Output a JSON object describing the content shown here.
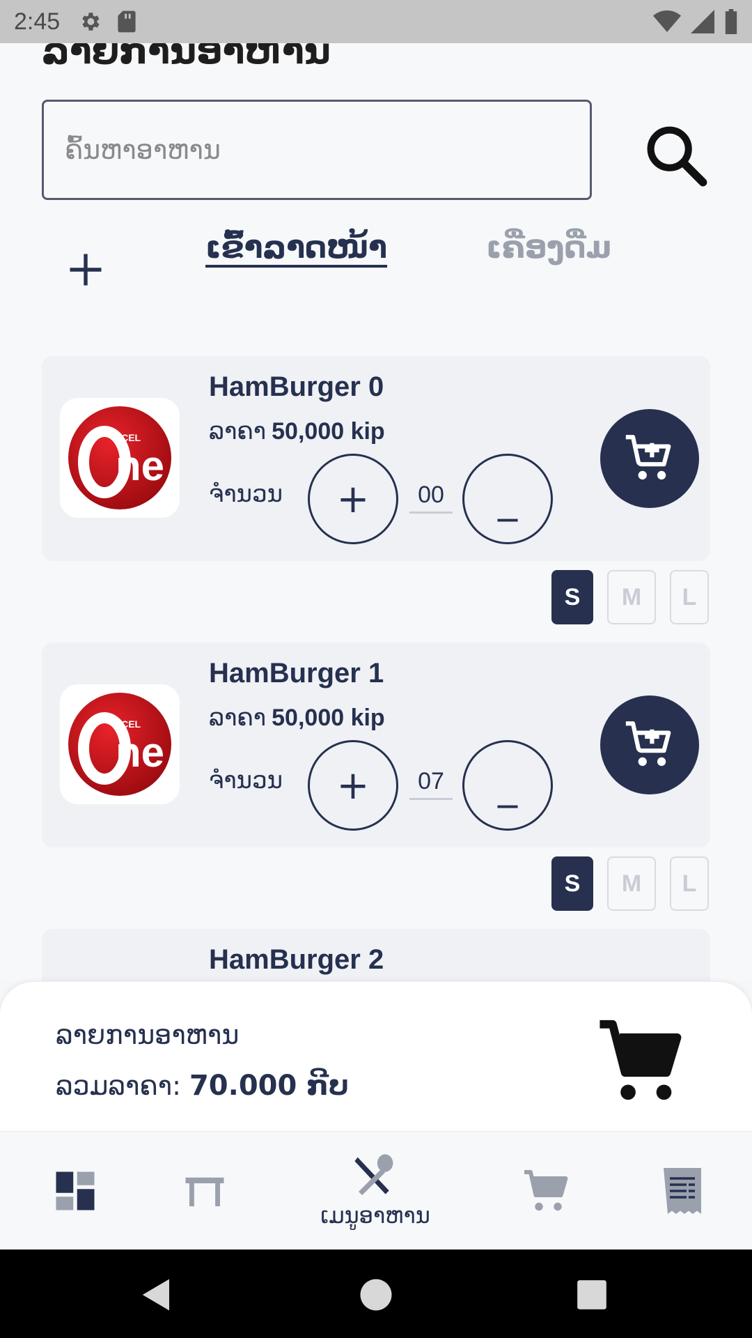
{
  "status_bar": {
    "time": "2:45"
  },
  "page": {
    "title": "ລາຍການອາຫານ"
  },
  "search": {
    "placeholder": "ຄົ້ນຫາອາຫານ"
  },
  "tabs": [
    {
      "label": "ເຂົ້າລາດໜ້າ",
      "active": true
    },
    {
      "label": "ເຄື່ອງດື່ມ",
      "active": false
    }
  ],
  "cards": [
    {
      "name": "HamBurger 0",
      "price_label": "ລາຄາ",
      "price": "50,000 kip",
      "qty_label": "ຈຳນວນ",
      "qty": "00",
      "sizes": [
        "S",
        "M",
        "L"
      ],
      "selected_size": "S"
    },
    {
      "name": "HamBurger 1",
      "price_label": "ລາຄາ",
      "price": "50,000 kip",
      "qty_label": "ຈຳນວນ",
      "qty": "07",
      "sizes": [
        "S",
        "M",
        "L"
      ],
      "selected_size": "S"
    },
    {
      "name": "HamBurger 2"
    }
  ],
  "qty_controls": {
    "plus": "+",
    "minus": "_"
  },
  "logo": {
    "text_small": "BCEL",
    "text_big": "One"
  },
  "summary": {
    "title": "ລາຍການອາຫານ",
    "total_label": "ລວມລາຄາ:",
    "total_value": "70.000 ກີບ"
  },
  "bottom_nav": [
    {
      "icon": "dashboard-icon",
      "label": ""
    },
    {
      "icon": "table-icon",
      "label": ""
    },
    {
      "icon": "food-menu-icon",
      "label": "ເມນູອາຫານ",
      "active": true
    },
    {
      "icon": "cart-icon",
      "label": ""
    },
    {
      "icon": "receipt-icon",
      "label": ""
    }
  ],
  "colors": {
    "primary": "#27304f",
    "inactive": "#9aa0ac",
    "card_bg": "#eff1f5",
    "logo_red": "#c8141b"
  }
}
